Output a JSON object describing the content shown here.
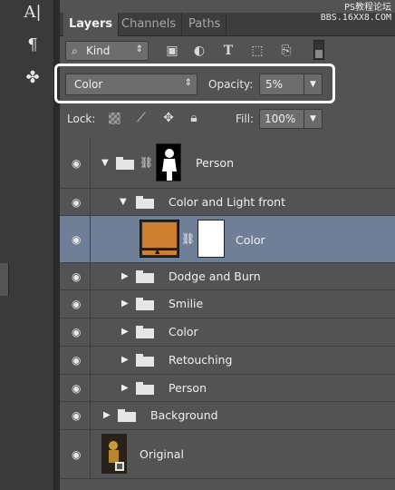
{
  "tabs": [
    "Layers",
    "Channels",
    "Paths"
  ],
  "watermark": {
    "line1": "PS教程论坛",
    "line2": "BBS.16XX8.COM"
  },
  "filter": {
    "kind_label": "Kind"
  },
  "blend": {
    "mode": "Color",
    "opacity_label": "Opacity:",
    "opacity_value": "5%"
  },
  "lock": {
    "label": "Lock:",
    "fill_label": "Fill:",
    "fill_value": "100%"
  },
  "layers": [
    {
      "name": "Person",
      "kind": "group-masked"
    },
    {
      "name": "Color and Light front",
      "kind": "group"
    },
    {
      "name": "Color",
      "kind": "fill-masked",
      "fill_color": "#cc8030"
    },
    {
      "name": "Dodge and Burn",
      "kind": "group"
    },
    {
      "name": "Smilie",
      "kind": "group"
    },
    {
      "name": "Color",
      "kind": "group"
    },
    {
      "name": "Retouching",
      "kind": "group"
    },
    {
      "name": "Person",
      "kind": "group"
    },
    {
      "name": "Background",
      "kind": "group"
    },
    {
      "name": "Original",
      "kind": "smart-object"
    }
  ],
  "colors": {
    "selected_row": "#6e7f97",
    "panel": "#535353",
    "highlight_border": "#ffffff"
  }
}
